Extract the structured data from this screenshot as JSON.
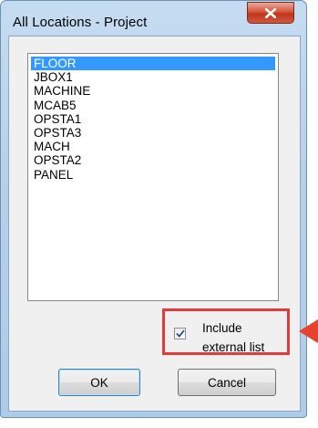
{
  "window": {
    "title": "All Locations - Project"
  },
  "locations": {
    "items": [
      "FLOOR",
      "JBOX1",
      "MACHINE",
      "MCAB5",
      "OPSTA1",
      "OPSTA3",
      "MACH",
      "OPSTA2",
      "PANEL"
    ],
    "selected_index": 0
  },
  "include_external": {
    "label_line1": "Include",
    "label_line2": "external list",
    "checked": true
  },
  "buttons": {
    "ok_label": "OK",
    "cancel_label": "Cancel"
  },
  "colors": {
    "selection": "#3399ff",
    "highlight_box": "#e23b3b",
    "close_button": "#c1341b"
  },
  "icons": {
    "close": "close-icon",
    "check": "checkmark-icon",
    "callout_arrow": "arrow-left-icon"
  }
}
